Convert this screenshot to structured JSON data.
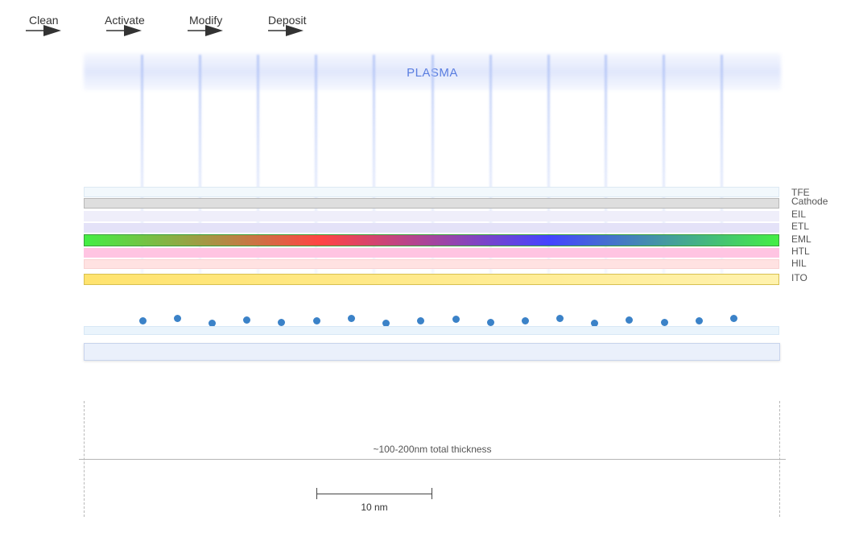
{
  "process_steps": [
    {
      "label": "Clean"
    },
    {
      "label": "Activate"
    },
    {
      "label": "Modify"
    },
    {
      "label": "Deposit"
    }
  ],
  "plasma": {
    "label": "PLASMA",
    "color": "#5a7ee0"
  },
  "layers": [
    {
      "label": "TFE",
      "color": "#f2f8fc"
    },
    {
      "label": "Cathode",
      "color": "#dedede"
    },
    {
      "label": "EIL",
      "color": "#efeefa"
    },
    {
      "label": "ETL",
      "color": "#e4e2f8"
    },
    {
      "label": "EML",
      "colors": [
        "#44ee44",
        "#ff4444",
        "#4444ff",
        "#44ee44"
      ]
    },
    {
      "label": "HTL",
      "color": "#ffc4e2"
    },
    {
      "label": "HIL",
      "color": "#ffe2e2"
    },
    {
      "label": "ITO",
      "color": "#ffe36e"
    }
  ],
  "annotations": {
    "thickness": "~100-200nm total thickness",
    "scale_bar": "10 nm"
  },
  "colors": {
    "molecule": "#3b82c8",
    "arrow": "#333333"
  }
}
